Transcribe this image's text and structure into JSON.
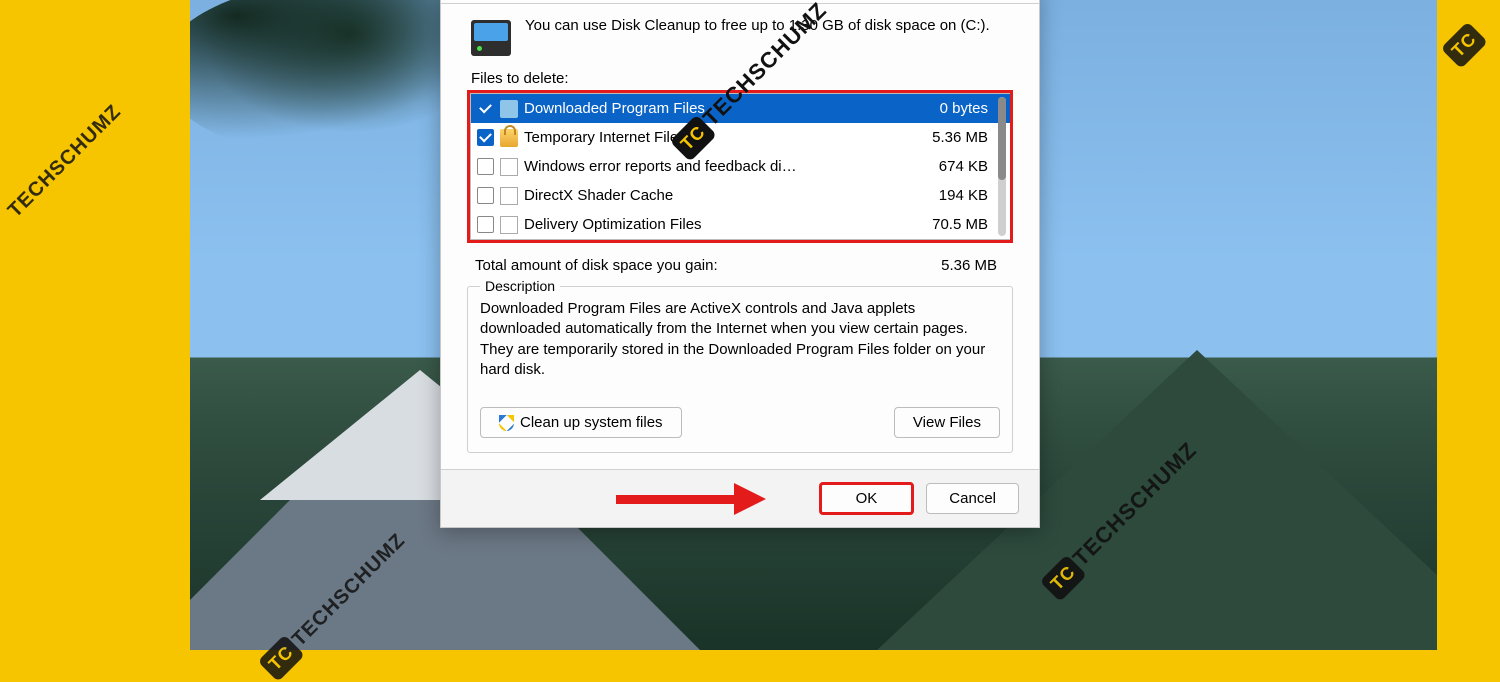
{
  "watermark": {
    "badge": "TC",
    "text": "TECHSCHUMZ"
  },
  "dialog": {
    "intro": "You can use Disk Cleanup to free up to 1.30 GB of disk space on  (C:).",
    "files_label": "Files to delete:",
    "items": [
      {
        "checked": true,
        "icon": "folder",
        "label": "Downloaded Program Files",
        "size": "0 bytes",
        "selected": true
      },
      {
        "checked": true,
        "icon": "lock",
        "label": "Temporary Internet Files",
        "size": "5.36 MB",
        "selected": false
      },
      {
        "checked": false,
        "icon": "file",
        "label": "Windows error reports and feedback di…",
        "size": "674 KB",
        "selected": false
      },
      {
        "checked": false,
        "icon": "file",
        "label": "DirectX Shader Cache",
        "size": "194 KB",
        "selected": false
      },
      {
        "checked": false,
        "icon": "file",
        "label": "Delivery Optimization Files",
        "size": "70.5 MB",
        "selected": false
      }
    ],
    "total_label": "Total amount of disk space you gain:",
    "total_value": "5.36 MB",
    "group_title": "Description",
    "description": "Downloaded Program Files are ActiveX controls and Java applets downloaded automatically from the Internet when you view certain pages. They are temporarily stored in the Downloaded Program Files folder on your hard disk.",
    "cleanup_btn": "Clean up system files",
    "viewfiles_btn": "View Files",
    "ok_btn": "OK",
    "cancel_btn": "Cancel"
  }
}
